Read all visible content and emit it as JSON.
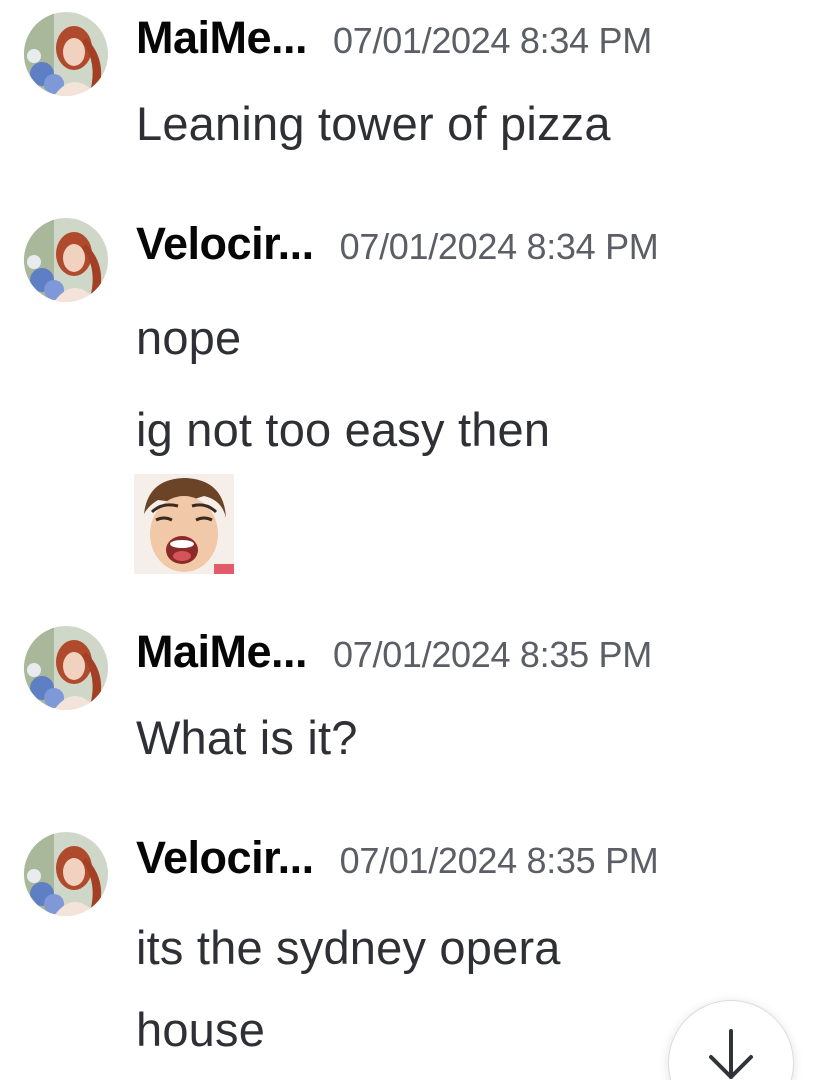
{
  "messages": [
    {
      "username": "MaiMe...",
      "timestamp": "07/01/2024 8:34 PM",
      "lines": [
        "Leaning tower of pizza"
      ]
    },
    {
      "username": "Velocir...",
      "timestamp": "07/01/2024 8:34 PM",
      "lines": [
        "nope",
        "ig not too easy then"
      ],
      "sticker": "screaming-face-emoji"
    },
    {
      "username": "MaiMe...",
      "timestamp": "07/01/2024 8:35 PM",
      "lines": [
        "What is it?"
      ]
    },
    {
      "username": "Velocir...",
      "timestamp": "07/01/2024 8:35 PM",
      "lines": [
        "its the sydney opera",
        "house"
      ]
    }
  ],
  "icons": {
    "jump_to_present": "arrow-down-icon"
  },
  "colors": {
    "username": "#060607",
    "timestamp": "#5c5e66",
    "message_text": "#2e3035",
    "background": "#ffffff"
  }
}
